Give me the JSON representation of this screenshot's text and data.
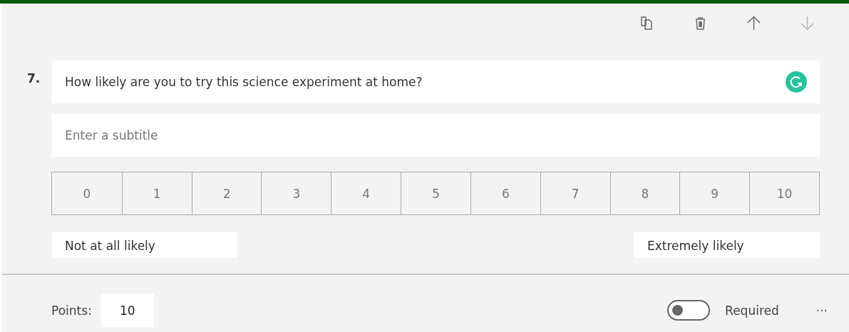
{
  "toolbar": [
    {
      "kind": "copy",
      "disabled": false
    },
    {
      "kind": "delete",
      "disabled": false
    },
    {
      "kind": "up",
      "disabled": false
    },
    {
      "kind": "down",
      "disabled": true
    }
  ],
  "question": {
    "number": "7.",
    "title": "How likely are you to try this science experiment at home?",
    "subtitle": {
      "placeholder": "Enter a subtitle"
    }
  },
  "scale": [
    "0",
    "1",
    "2",
    "3",
    "4",
    "5",
    "6",
    "7",
    "8",
    "9",
    "10"
  ],
  "labels": {
    "low": "Not at all likely",
    "high": "Extremely likely"
  },
  "footer": {
    "points_label": "Points:",
    "points_value": "10",
    "required": {
      "label": "Required",
      "on": false
    },
    "more": "···"
  }
}
